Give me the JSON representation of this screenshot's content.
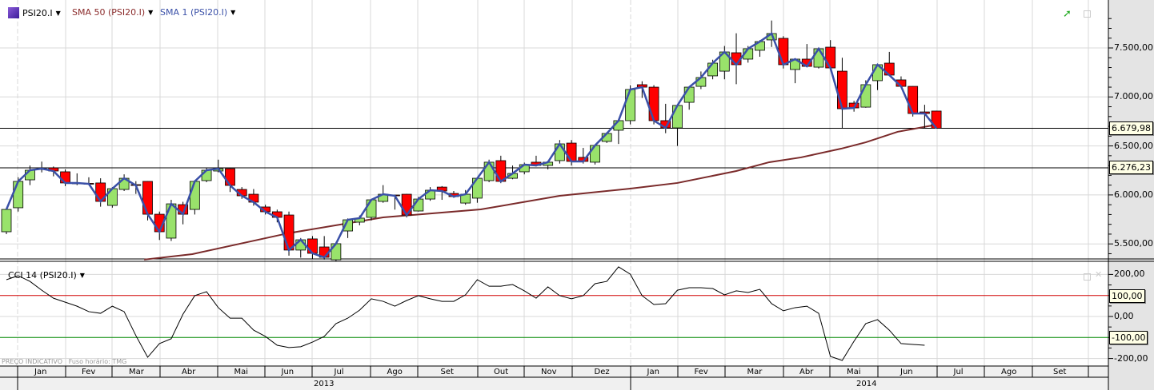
{
  "legend": {
    "instrument": "PSI20.I",
    "sma50": "SMA 50 (PSI20.I)",
    "sma1": "SMA 1 (PSI20.I)",
    "cci": "CCI 14 (PSI20.I)"
  },
  "colors": {
    "up": "#99e26b",
    "down": "#ff0000",
    "sma50": "#7a2a2a",
    "sma1": "#3a50a8",
    "cci": "#000000",
    "cci_upper": "#d00000",
    "cci_lower": "#008800"
  },
  "price_axis": [
    "7.500,00",
    "7.000,00",
    "6.500,00",
    "6.000,00",
    "5.500,00"
  ],
  "price_levels": [
    7500,
    7000,
    6500,
    6000,
    5500
  ],
  "hlines": [
    {
      "value": 6679.98,
      "label": "6.679,98"
    },
    {
      "value": 6276.23,
      "label": "6.276,23"
    }
  ],
  "cci_axis": [
    "200,00",
    "0,00",
    "-200,00"
  ],
  "cci_levels": [
    {
      "value": 100,
      "label": "100,00"
    },
    {
      "value": -100,
      "label": "-100,00"
    }
  ],
  "footer": {
    "price_note": "PREÇO INDICATIVO",
    "timezone": "Fuso horário: TMG"
  },
  "months": [
    "Jan",
    "Fev",
    "Mar",
    "Abr",
    "Mai",
    "Jun",
    "Jul",
    "Ago",
    "Set",
    "Out",
    "Nov",
    "Dez",
    "Jan",
    "Fev",
    "Mar",
    "Abr",
    "Mai",
    "Jun",
    "Jul",
    "Ago",
    "Set"
  ],
  "years": [
    "2013",
    "2014"
  ],
  "chart_data": {
    "type": "candlestick",
    "ohlc": [
      [
        5624,
        5870,
        5600,
        5852
      ],
      [
        5869,
        6180,
        5830,
        6138
      ],
      [
        6154,
        6300,
        6100,
        6252
      ],
      [
        6260,
        6340,
        6230,
        6268
      ],
      [
        6276,
        6290,
        6190,
        6244
      ],
      [
        6236,
        6260,
        6090,
        6122
      ],
      [
        6122,
        6220,
        6100,
        6122
      ],
      [
        6118,
        6180,
        6100,
        6113
      ],
      [
        6122,
        6170,
        5880,
        5934
      ],
      [
        5893,
        6080,
        5870,
        6064
      ],
      [
        6056,
        6210,
        6040,
        6170
      ],
      [
        6105,
        6140,
        6010,
        6097
      ],
      [
        6138,
        6140,
        5740,
        5803
      ],
      [
        5803,
        5830,
        5540,
        5624
      ],
      [
        5559,
        5950,
        5530,
        5909
      ],
      [
        5901,
        5930,
        5700,
        5803
      ],
      [
        5852,
        6150,
        5800,
        6138
      ],
      [
        6146,
        6280,
        6130,
        6252
      ],
      [
        6244,
        6360,
        6230,
        6268
      ],
      [
        6268,
        6270,
        6030,
        6097
      ],
      [
        6056,
        6080,
        5960,
        5991
      ],
      [
        6007,
        6060,
        5890,
        5926
      ],
      [
        5877,
        5900,
        5800,
        5828
      ],
      [
        5828,
        5850,
        5720,
        5771
      ],
      [
        5795,
        5830,
        5380,
        5437
      ],
      [
        5437,
        5560,
        5360,
        5542
      ],
      [
        5551,
        5580,
        5350,
        5404
      ],
      [
        5469,
        5580,
        5340,
        5363
      ],
      [
        5338,
        5520,
        5320,
        5502
      ],
      [
        5632,
        5760,
        5560,
        5746
      ],
      [
        5722,
        5790,
        5690,
        5763
      ],
      [
        5771,
        5950,
        5740,
        5950
      ],
      [
        5934,
        6100,
        5920,
        6007
      ],
      [
        5999,
        6000,
        5850,
        5991
      ],
      [
        6007,
        6010,
        5770,
        5795
      ],
      [
        5836,
        5980,
        5830,
        5958
      ],
      [
        5958,
        6080,
        5940,
        6048
      ],
      [
        6080,
        6090,
        5950,
        6040
      ],
      [
        6015,
        6040,
        5970,
        5983
      ],
      [
        5917,
        6050,
        5900,
        6007
      ],
      [
        5967,
        6170,
        5920,
        6170
      ],
      [
        6146,
        6360,
        6130,
        6334
      ],
      [
        6350,
        6400,
        6120,
        6138
      ],
      [
        6170,
        6300,
        6160,
        6219
      ],
      [
        6236,
        6330,
        6210,
        6309
      ],
      [
        6334,
        6400,
        6290,
        6301
      ],
      [
        6301,
        6350,
        6260,
        6334
      ],
      [
        6350,
        6560,
        6320,
        6521
      ],
      [
        6529,
        6560,
        6300,
        6342
      ],
      [
        6383,
        6480,
        6320,
        6342
      ],
      [
        6334,
        6505,
        6310,
        6505
      ],
      [
        6546,
        6640,
        6530,
        6627
      ],
      [
        6660,
        6760,
        6520,
        6758
      ],
      [
        6758,
        7120,
        6720,
        7076
      ],
      [
        7125,
        7160,
        6990,
        7100
      ],
      [
        7100,
        7120,
        6720,
        6758
      ],
      [
        6758,
        6930,
        6630,
        6684
      ],
      [
        6684,
        6913,
        6500,
        6913
      ],
      [
        6945,
        7100,
        6870,
        7100
      ],
      [
        7108,
        7260,
        7080,
        7198
      ],
      [
        7215,
        7380,
        7180,
        7345
      ],
      [
        7263,
        7520,
        7180,
        7459
      ],
      [
        7451,
        7650,
        7130,
        7329
      ],
      [
        7386,
        7520,
        7350,
        7492
      ],
      [
        7476,
        7580,
        7410,
        7565
      ],
      [
        7582,
        7780,
        7510,
        7647
      ],
      [
        7598,
        7620,
        7290,
        7329
      ],
      [
        7280,
        7390,
        7140,
        7386
      ],
      [
        7386,
        7540,
        7320,
        7312
      ],
      [
        7304,
        7500,
        7290,
        7492
      ],
      [
        7508,
        7580,
        7300,
        7296
      ],
      [
        7263,
        7400,
        6680,
        6880
      ],
      [
        6937,
        6960,
        6850,
        6888
      ],
      [
        6896,
        7170,
        6890,
        7125
      ],
      [
        7166,
        7330,
        7070,
        7329
      ],
      [
        7345,
        7460,
        7230,
        7223
      ],
      [
        7174,
        7210,
        7120,
        7108
      ],
      [
        7108,
        7110,
        6800,
        6831
      ],
      [
        6847,
        6920,
        6680,
        6831
      ],
      [
        6856,
        6860,
        6680,
        6680
      ]
    ],
    "sma50": [
      [
        11.7,
        5340
      ],
      [
        15.8,
        5396
      ],
      [
        23.9,
        5608
      ],
      [
        32,
        5771
      ],
      [
        40.3,
        5852
      ],
      [
        47,
        5991
      ],
      [
        53,
        6064
      ],
      [
        57,
        6122
      ],
      [
        62,
        6244
      ],
      [
        64.8,
        6334
      ],
      [
        67.5,
        6383
      ],
      [
        70.9,
        6472
      ],
      [
        73,
        6537
      ],
      [
        75.7,
        6644
      ],
      [
        79,
        6717
      ]
    ],
    "cci": [
      175,
      194,
      167,
      125,
      87,
      68,
      49,
      23,
      15,
      49,
      23,
      -91,
      -194,
      -129,
      -106,
      11,
      99,
      118,
      42,
      -8,
      -8,
      -65,
      -95,
      -137,
      -148,
      -144,
      -122,
      -95,
      -34,
      -8,
      30,
      84,
      72,
      49,
      76,
      99,
      84,
      72,
      72,
      103,
      175,
      144,
      144,
      152,
      122,
      87,
      141,
      99,
      84,
      99,
      156,
      167,
      236,
      201,
      99,
      57,
      61,
      125,
      137,
      137,
      133,
      103,
      122,
      114,
      129,
      61,
      27,
      42,
      49,
      15,
      -190,
      -209,
      -118,
      -34,
      -15,
      -65,
      -129,
      -133,
      -137
    ],
    "price_range": [
      5340,
      7780
    ],
    "cci_range": [
      -200,
      200
    ]
  }
}
